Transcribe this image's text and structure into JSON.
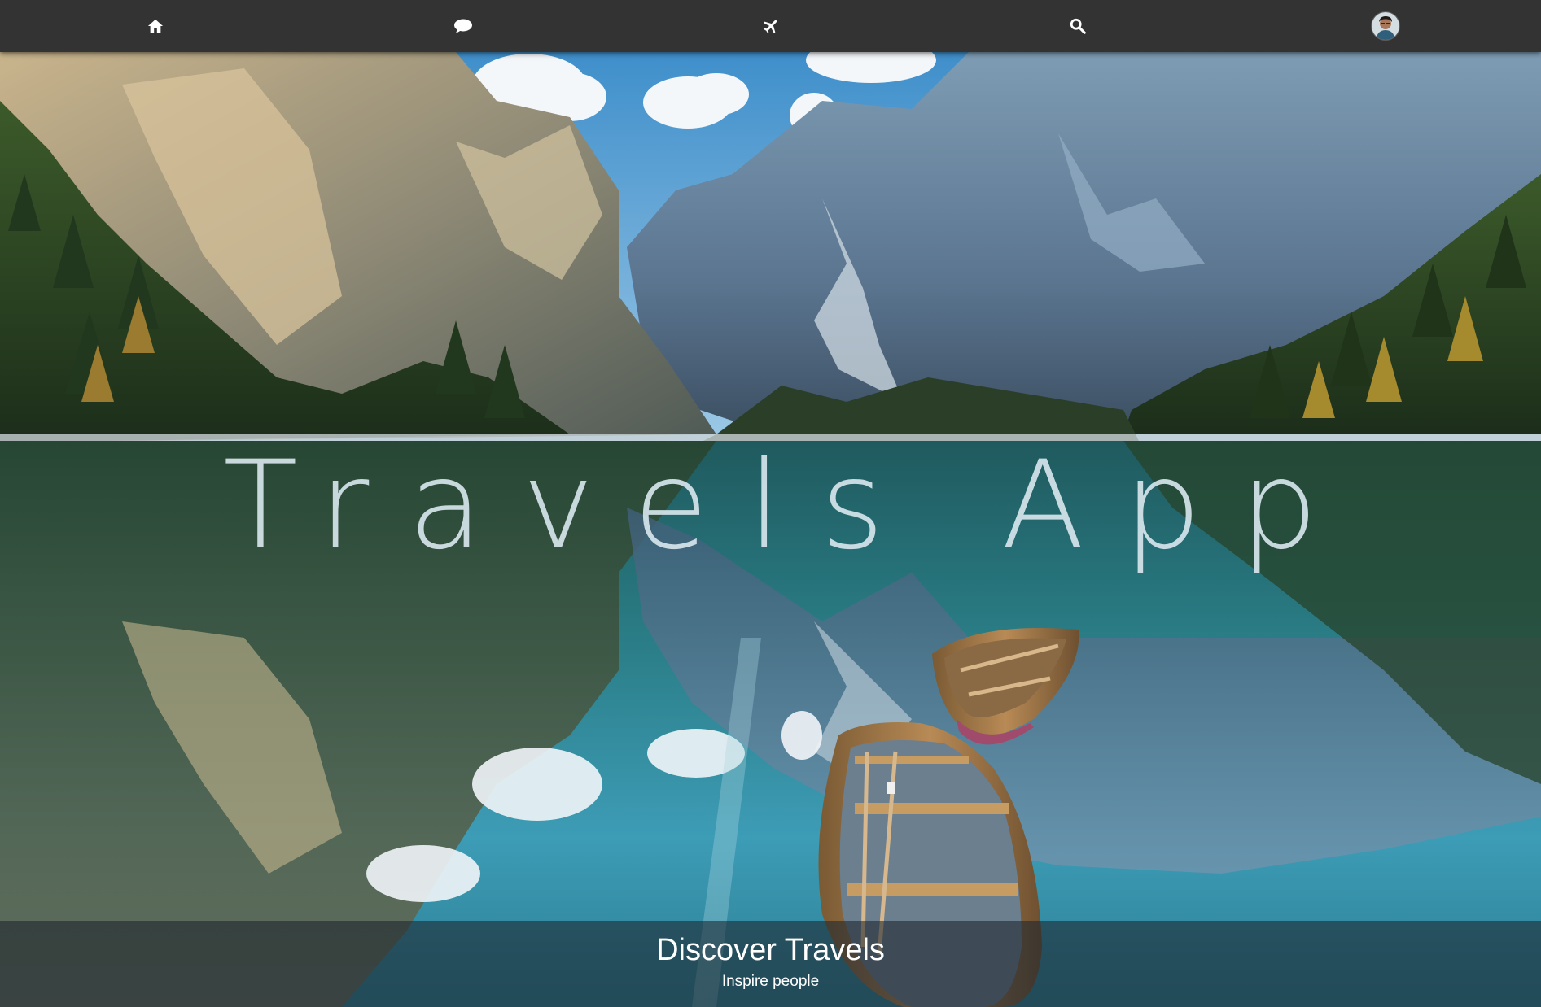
{
  "nav": {
    "items": [
      {
        "id": "home",
        "icon": "home-icon",
        "label": ""
      },
      {
        "id": "chat",
        "icon": "chat-bubble-icon",
        "label": ""
      },
      {
        "id": "flights",
        "icon": "airplane-icon",
        "label": ""
      },
      {
        "id": "search",
        "icon": "search-icon",
        "label": ""
      },
      {
        "id": "profile",
        "icon": "avatar",
        "label": ""
      }
    ],
    "background_color": "#333333",
    "icon_color": "#ffffff"
  },
  "hero": {
    "title": "Travels App",
    "image_description_icon": "mountain-lake-with-boats-image"
  },
  "caption": {
    "title": "Discover Travels",
    "subtitle": "Inspire people"
  }
}
